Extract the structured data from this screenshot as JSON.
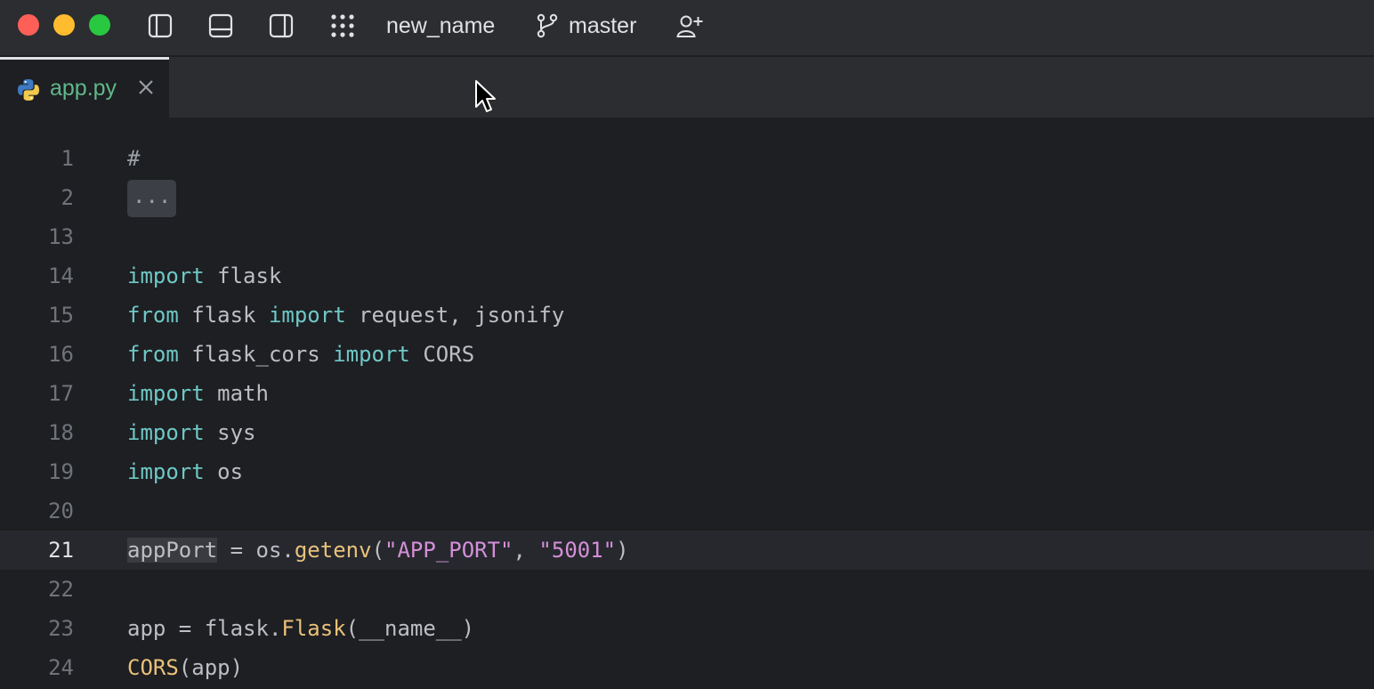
{
  "titlebar": {
    "project_name": "new_name",
    "branch": "master"
  },
  "tabs": [
    {
      "label": "app.py",
      "active": true
    }
  ],
  "editor": {
    "current_line": "21",
    "lines": [
      {
        "num": "1",
        "segments": [
          {
            "t": "#",
            "c": "cm"
          }
        ]
      },
      {
        "num": "2",
        "fold": "..."
      },
      {
        "num": "13",
        "segments": []
      },
      {
        "num": "14",
        "segments": [
          {
            "t": "import",
            "c": "kw"
          },
          {
            "t": " flask",
            "c": ""
          }
        ]
      },
      {
        "num": "15",
        "segments": [
          {
            "t": "from",
            "c": "kw"
          },
          {
            "t": " flask ",
            "c": ""
          },
          {
            "t": "import",
            "c": "kw"
          },
          {
            "t": " request, jsonify",
            "c": ""
          }
        ]
      },
      {
        "num": "16",
        "segments": [
          {
            "t": "from",
            "c": "kw"
          },
          {
            "t": " flask_cors ",
            "c": ""
          },
          {
            "t": "import",
            "c": "kw"
          },
          {
            "t": " CORS",
            "c": ""
          }
        ]
      },
      {
        "num": "17",
        "segments": [
          {
            "t": "import",
            "c": "kw"
          },
          {
            "t": " math",
            "c": ""
          }
        ]
      },
      {
        "num": "18",
        "segments": [
          {
            "t": "import",
            "c": "kw"
          },
          {
            "t": " sys",
            "c": ""
          }
        ]
      },
      {
        "num": "19",
        "segments": [
          {
            "t": "import",
            "c": "kw"
          },
          {
            "t": " os",
            "c": ""
          }
        ]
      },
      {
        "num": "20",
        "segments": []
      },
      {
        "num": "21",
        "segments": [
          {
            "t": "appPort",
            "c": "hl"
          },
          {
            "t": " = os.",
            "c": ""
          },
          {
            "t": "getenv",
            "c": "fn"
          },
          {
            "t": "(",
            "c": ""
          },
          {
            "t": "\"APP_PORT\"",
            "c": "str"
          },
          {
            "t": ", ",
            "c": ""
          },
          {
            "t": "\"5001\"",
            "c": "str"
          },
          {
            "t": ")",
            "c": ""
          }
        ]
      },
      {
        "num": "22",
        "segments": []
      },
      {
        "num": "23",
        "segments": [
          {
            "t": "app = flask.",
            "c": ""
          },
          {
            "t": "Flask",
            "c": "fn"
          },
          {
            "t": "(__name__)",
            "c": ""
          }
        ]
      },
      {
        "num": "24",
        "segments": [
          {
            "t": "CORS",
            "c": "fn"
          },
          {
            "t": "(app)",
            "c": ""
          }
        ]
      }
    ]
  },
  "colors": {
    "keyword": "#6ec8c7",
    "function": "#e8c17a",
    "string": "#d58fd8",
    "tab_label": "#5fb88b"
  }
}
